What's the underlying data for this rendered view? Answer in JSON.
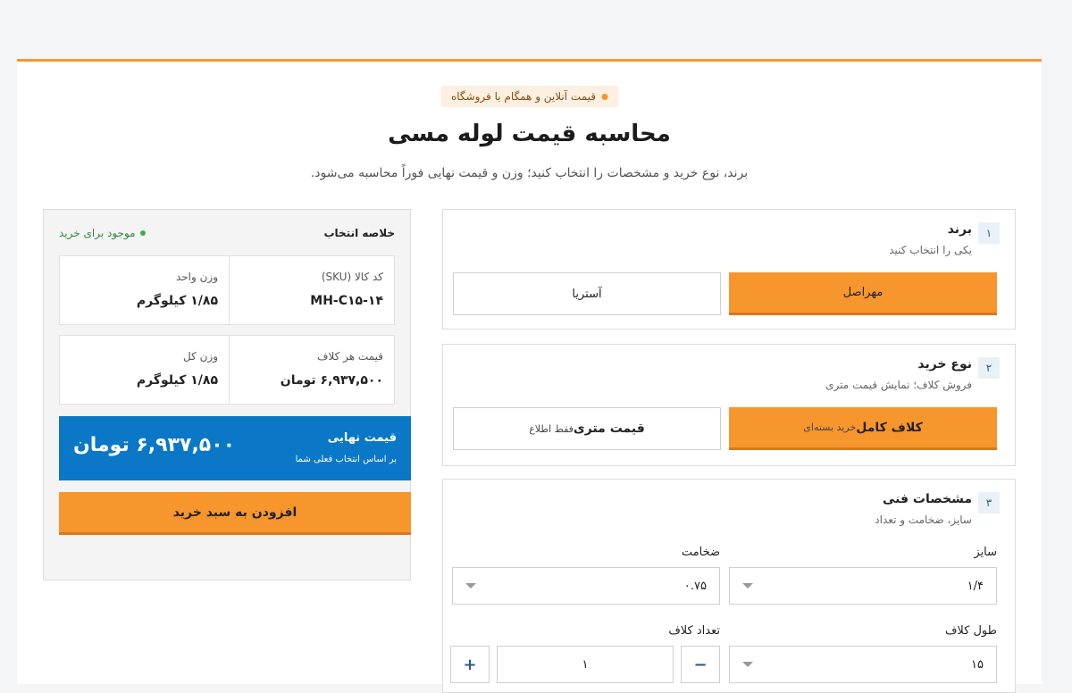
{
  "header": {
    "badge": "قیمت آنلاین و همگام با فروشگاه",
    "title": "محاسبه قیمت لوله مسی",
    "subtitle": "برند، نوع خرید و مشخصات را انتخاب کنید؛ وزن و قیمت نهایی فوراً محاسبه می‌شود."
  },
  "brand_step": {
    "num": "۱",
    "title": "برند",
    "sub": "یکی را انتخاب کنید",
    "options": [
      "مهراصل",
      "آستریا"
    ]
  },
  "purchase_step": {
    "num": "۲",
    "title": "نوع خرید",
    "sub": "فروش کلاف؛ نمایش قیمت متری",
    "opt1_bold": "کلاف کامل",
    "opt1_small": "خرید بسته‌ای",
    "opt2_bold": "قیمت متری",
    "opt2_small": "فقط اطلاع"
  },
  "spec_step": {
    "num": "۳",
    "title": "مشخصات فنی",
    "sub": "سایز، ضخامت و تعداد",
    "size_label": "سایز",
    "size_value": "۱/۴",
    "thickness_label": "ضخامت",
    "thickness_value": "۰.۷۵",
    "length_label": "طول کلاف",
    "length_value": "۱۵",
    "count_label": "تعداد کلاف",
    "count_value": "۱",
    "minus": "−",
    "plus": "+"
  },
  "summary": {
    "title": "خلاصه انتخاب",
    "stock": "موجود برای خرید",
    "sku_label": "کد کالا (SKU)",
    "sku_value": "MH-C۱۵-۱۴",
    "unit_weight_label": "وزن واحد",
    "unit_weight_value": "۱/۸۵ کیلوگرم",
    "coil_price_label": "قیمت هر کلاف",
    "coil_price_value": "۶,۹۳۷,۵۰۰ تومان",
    "total_weight_label": "وزن کل",
    "total_weight_value": "۱/۸۵ کیلوگرم",
    "final_label": "قیمت نهایی",
    "final_sub": "بر اساس انتخاب فعلی شما",
    "final_value": "۶,۹۳۷,۵۰۰ تومان",
    "add_button": "افزودن به سبد خرید"
  }
}
